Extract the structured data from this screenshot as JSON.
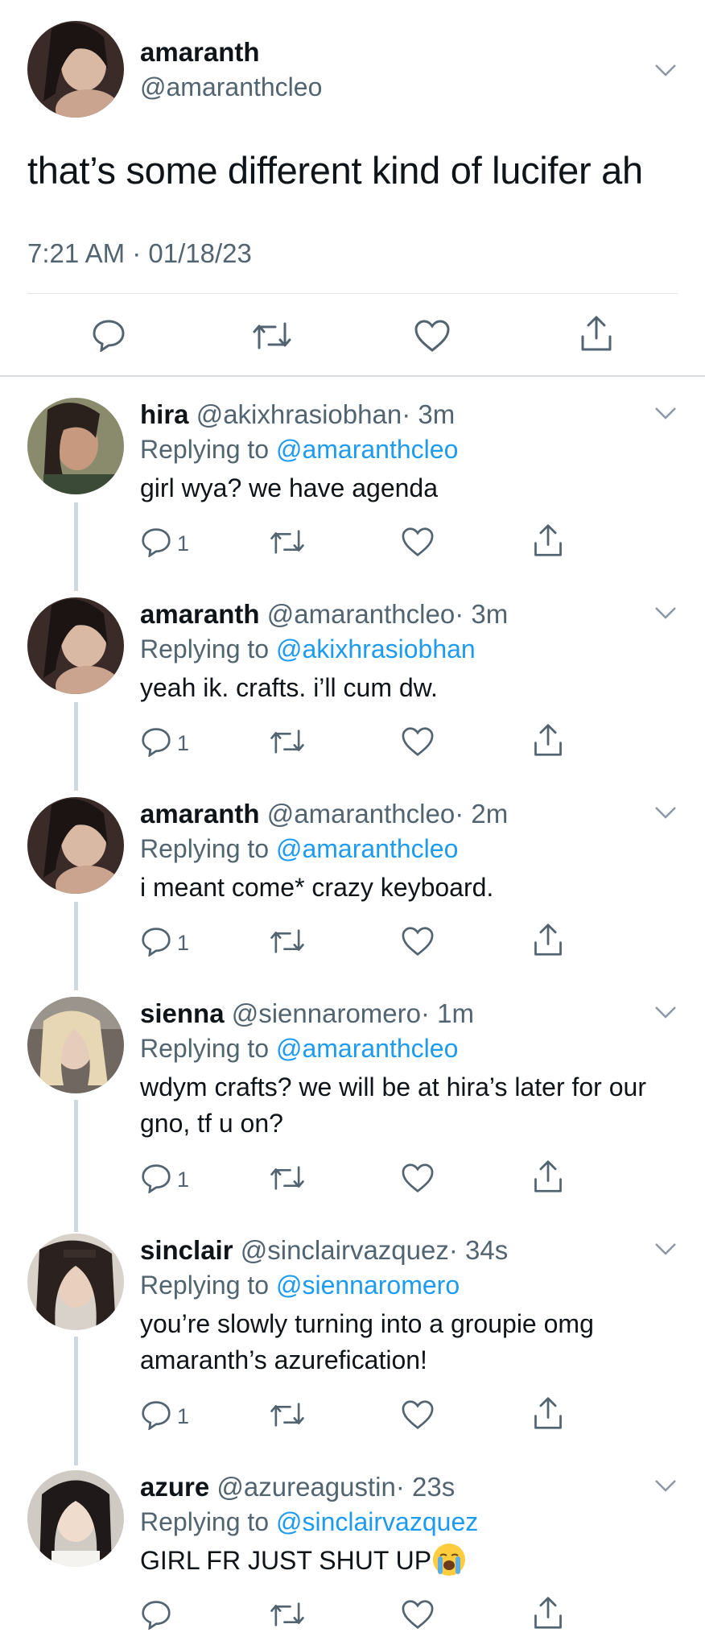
{
  "tweet": {
    "name": "amaranth",
    "handle": "@amaranthcleo",
    "text": "that’s some different kind of lucifer ah",
    "timestamp": "7:21 AM · 01/18/23"
  },
  "replies": [
    {
      "name": "hira",
      "handle": "@akixhrasiobhan",
      "time": "· 3m",
      "replying_label": "Replying to",
      "replying_to": "@amaranthcleo",
      "text": "girl wya? we have agenda",
      "reply_count": "1"
    },
    {
      "name": "amaranth",
      "handle": "@amaranthcleo",
      "time": "· 3m",
      "replying_label": "Replying to",
      "replying_to": "@akixhrasiobhan",
      "text": "yeah ik. crafts. i’ll cum dw.",
      "reply_count": "1"
    },
    {
      "name": "amaranth",
      "handle": "@amaranthcleo",
      "time": "· 2m",
      "replying_label": "Replying to",
      "replying_to": "@amaranthcleo",
      "text": "i meant come* crazy keyboard.",
      "reply_count": "1"
    },
    {
      "name": "sienna",
      "handle": "@siennaromero",
      "time": "· 1m",
      "replying_label": "Replying to",
      "replying_to": "@amaranthcleo",
      "text": "wdym crafts? we will be at hira’s later for our gno, tf u on?",
      "reply_count": "1"
    },
    {
      "name": "sinclair",
      "handle": "@sinclairvazquez",
      "time": "· 34s",
      "replying_label": "Replying to",
      "replying_to": "@siennaromero",
      "text": "you’re slowly turning into a groupie omg amaranth’s azurefication!",
      "reply_count": "1"
    },
    {
      "name": "azure",
      "handle": "@azureagustin",
      "time": "· 23s",
      "replying_label": "Replying to",
      "replying_to": "@sinclairvazquez",
      "text": "GIRL FR JUST SHUT UP",
      "reply_count": ""
    }
  ],
  "icons": {
    "reply": "reply-icon",
    "retweet": "retweet-icon",
    "like": "heart-icon",
    "share": "share-icon",
    "more": "chevron-down-icon",
    "emoji": "loudly-crying-face-icon"
  },
  "colors": {
    "link": "#1d9bf0",
    "muted": "#536471",
    "text": "#0f1419",
    "divider": "#dfe3e6",
    "thread": "#cfd9de"
  }
}
